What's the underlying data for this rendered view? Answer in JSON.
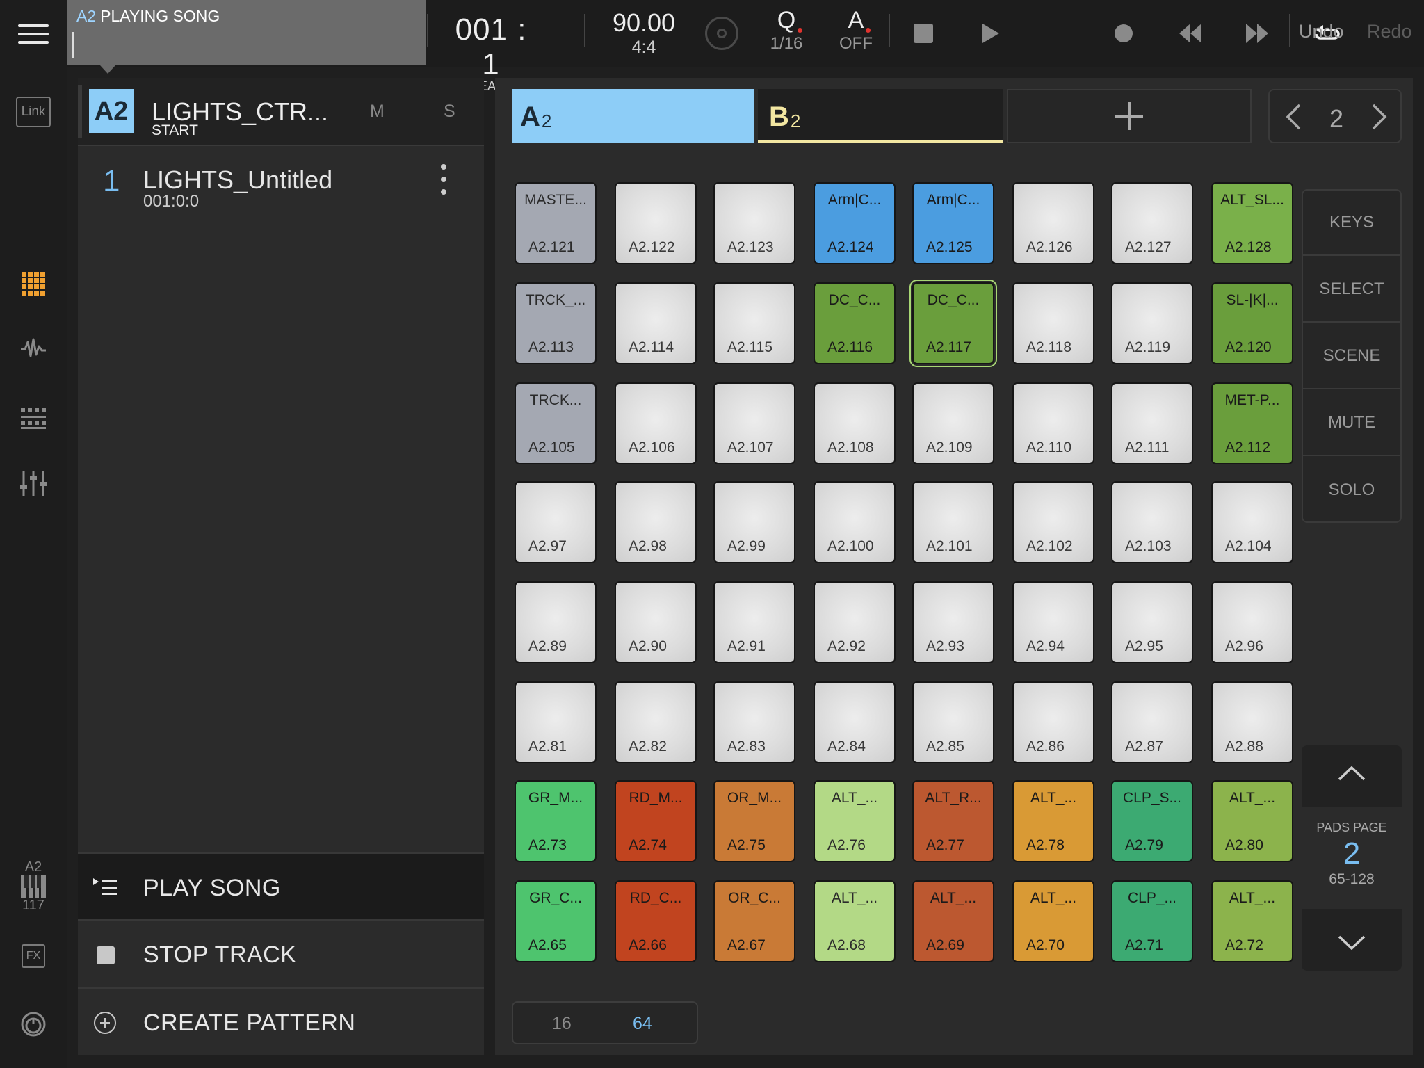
{
  "topbar": {
    "song_track": "A2",
    "song_status": "PLAYING SONG",
    "position": "001 : 1",
    "position_unit": "BEATS",
    "tempo": "90.00",
    "time_signature": "4:4",
    "quantize_label": "Q",
    "quantize_value": "1/16",
    "automation_label": "A",
    "automation_value": "OFF",
    "undo": "Undo",
    "redo": "Redo"
  },
  "sidebar": {
    "link_label": "Link",
    "keyboard_track": "A2",
    "keyboard_count": "117",
    "fx_label": "FX",
    "accent_color": "#f0a030"
  },
  "track": {
    "badge": "A2",
    "name": "LIGHTS_CTR...",
    "sub": "START",
    "mute": "M",
    "solo": "S",
    "pattern": {
      "number": "1",
      "name": "LIGHTS_Untitled",
      "time": "001:0:0"
    }
  },
  "actions": {
    "play_song": "PLAY SONG",
    "stop_track": "STOP TRACK",
    "create_pattern": "CREATE PATTERN"
  },
  "banks": {
    "tabs": [
      {
        "letter": "A",
        "sub": "2",
        "color": "#8dcdf7"
      },
      {
        "letter": "B",
        "sub": "2",
        "color": "#f3e7a2"
      }
    ],
    "page": "2"
  },
  "modes": [
    "KEYS",
    "SELECT",
    "SCENE",
    "MUTE",
    "SOLO"
  ],
  "pads_page": {
    "label": "PADS PAGE",
    "number": "2",
    "range": "65-128"
  },
  "pad_size": {
    "options": [
      "16",
      "64"
    ],
    "selected": "64"
  },
  "pad_colors": {
    "grey": "#a4a8b2",
    "white": "#dcdcdc",
    "blue": "#4b9de0",
    "green": "#6a9e3c",
    "limegreen": "#7ab04a",
    "brightgreen": "#4ec46e",
    "red": "#c1441f",
    "orange": "#c97a36",
    "lightgreen": "#b3d986",
    "rust": "#bc5830",
    "amber": "#d99a35",
    "teal": "#3caa72",
    "olive": "#8cb34c"
  },
  "pads": [
    [
      {
        "name": "MASTE...",
        "id": "A2.121",
        "color": "grey"
      },
      {
        "name": "",
        "id": "A2.122",
        "color": "white"
      },
      {
        "name": "",
        "id": "A2.123",
        "color": "white"
      },
      {
        "name": "Arm|C...",
        "id": "A2.124",
        "color": "blue"
      },
      {
        "name": "Arm|C...",
        "id": "A2.125",
        "color": "blue"
      },
      {
        "name": "",
        "id": "A2.126",
        "color": "white"
      },
      {
        "name": "",
        "id": "A2.127",
        "color": "white"
      },
      {
        "name": "ALT_SL...",
        "id": "A2.128",
        "color": "limegreen"
      }
    ],
    [
      {
        "name": "TRCK_...",
        "id": "A2.113",
        "color": "grey"
      },
      {
        "name": "",
        "id": "A2.114",
        "color": "white"
      },
      {
        "name": "",
        "id": "A2.115",
        "color": "white"
      },
      {
        "name": "DC_C...",
        "id": "A2.116",
        "color": "green"
      },
      {
        "name": "DC_C...",
        "id": "A2.117",
        "color": "green",
        "selected": true
      },
      {
        "name": "",
        "id": "A2.118",
        "color": "white"
      },
      {
        "name": "",
        "id": "A2.119",
        "color": "white"
      },
      {
        "name": "SL-|K|...",
        "id": "A2.120",
        "color": "green"
      }
    ],
    [
      {
        "name": "TRCK...",
        "id": "A2.105",
        "color": "grey"
      },
      {
        "name": "",
        "id": "A2.106",
        "color": "white"
      },
      {
        "name": "",
        "id": "A2.107",
        "color": "white"
      },
      {
        "name": "",
        "id": "A2.108",
        "color": "white"
      },
      {
        "name": "",
        "id": "A2.109",
        "color": "white"
      },
      {
        "name": "",
        "id": "A2.110",
        "color": "white"
      },
      {
        "name": "",
        "id": "A2.111",
        "color": "white"
      },
      {
        "name": "MET-P...",
        "id": "A2.112",
        "color": "green"
      }
    ],
    [
      {
        "name": "",
        "id": "A2.97",
        "color": "white"
      },
      {
        "name": "",
        "id": "A2.98",
        "color": "white"
      },
      {
        "name": "",
        "id": "A2.99",
        "color": "white"
      },
      {
        "name": "",
        "id": "A2.100",
        "color": "white"
      },
      {
        "name": "",
        "id": "A2.101",
        "color": "white"
      },
      {
        "name": "",
        "id": "A2.102",
        "color": "white"
      },
      {
        "name": "",
        "id": "A2.103",
        "color": "white"
      },
      {
        "name": "",
        "id": "A2.104",
        "color": "white"
      }
    ],
    [
      {
        "name": "",
        "id": "A2.89",
        "color": "white"
      },
      {
        "name": "",
        "id": "A2.90",
        "color": "white"
      },
      {
        "name": "",
        "id": "A2.91",
        "color": "white"
      },
      {
        "name": "",
        "id": "A2.92",
        "color": "white"
      },
      {
        "name": "",
        "id": "A2.93",
        "color": "white"
      },
      {
        "name": "",
        "id": "A2.94",
        "color": "white"
      },
      {
        "name": "",
        "id": "A2.95",
        "color": "white"
      },
      {
        "name": "",
        "id": "A2.96",
        "color": "white"
      }
    ],
    [
      {
        "name": "",
        "id": "A2.81",
        "color": "white"
      },
      {
        "name": "",
        "id": "A2.82",
        "color": "white"
      },
      {
        "name": "",
        "id": "A2.83",
        "color": "white"
      },
      {
        "name": "",
        "id": "A2.84",
        "color": "white"
      },
      {
        "name": "",
        "id": "A2.85",
        "color": "white"
      },
      {
        "name": "",
        "id": "A2.86",
        "color": "white"
      },
      {
        "name": "",
        "id": "A2.87",
        "color": "white"
      },
      {
        "name": "",
        "id": "A2.88",
        "color": "white"
      }
    ],
    [
      {
        "name": "GR_M...",
        "id": "A2.73",
        "color": "brightgreen"
      },
      {
        "name": "RD_M...",
        "id": "A2.74",
        "color": "red"
      },
      {
        "name": "OR_M...",
        "id": "A2.75",
        "color": "orange"
      },
      {
        "name": "ALT_...",
        "id": "A2.76",
        "color": "lightgreen"
      },
      {
        "name": "ALT_R...",
        "id": "A2.77",
        "color": "rust"
      },
      {
        "name": "ALT_...",
        "id": "A2.78",
        "color": "amber"
      },
      {
        "name": "CLP_S...",
        "id": "A2.79",
        "color": "teal"
      },
      {
        "name": "ALT_...",
        "id": "A2.80",
        "color": "olive"
      }
    ],
    [
      {
        "name": "GR_C...",
        "id": "A2.65",
        "color": "brightgreen"
      },
      {
        "name": "RD_C...",
        "id": "A2.66",
        "color": "red"
      },
      {
        "name": "OR_C...",
        "id": "A2.67",
        "color": "orange"
      },
      {
        "name": "ALT_...",
        "id": "A2.68",
        "color": "lightgreen"
      },
      {
        "name": "ALT_...",
        "id": "A2.69",
        "color": "rust"
      },
      {
        "name": "ALT_...",
        "id": "A2.70",
        "color": "amber"
      },
      {
        "name": "CLP_...",
        "id": "A2.71",
        "color": "teal"
      },
      {
        "name": "ALT_...",
        "id": "A2.72",
        "color": "olive"
      }
    ]
  ]
}
